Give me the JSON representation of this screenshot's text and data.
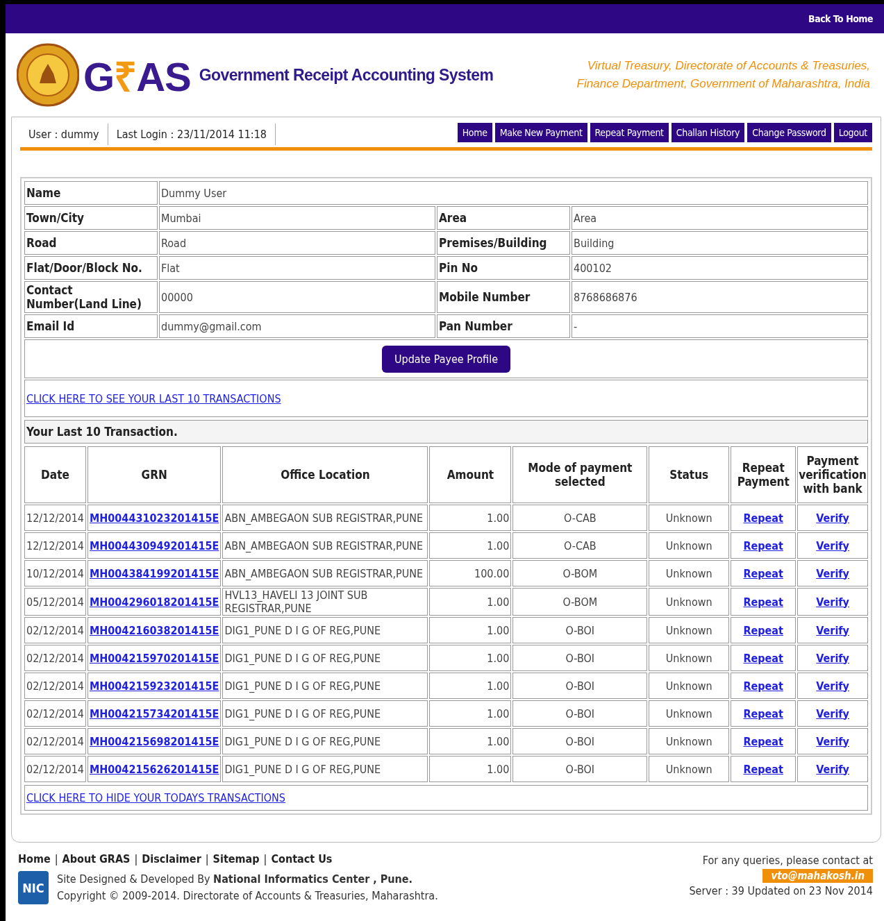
{
  "top_bar": {
    "link": "Back To Home"
  },
  "header": {
    "logo_text_left": "G",
    "logo_text_rupee": "₹",
    "logo_text_right": "AS",
    "system_name": "Government Receipt Accounting System",
    "org_lines": [
      "Virtual Treasury, Directorate of Accounts & Treasuries,",
      "Finance Department, Government of Maharashtra, India"
    ]
  },
  "user_bar": {
    "user": "User : dummy",
    "last_login": "Last Login : 23/11/2014 11:18"
  },
  "nav": [
    {
      "label": "Home"
    },
    {
      "label": "Make New Payment"
    },
    {
      "label": "Repeat Payment"
    },
    {
      "label": "Challan History"
    },
    {
      "label": "Change Password"
    },
    {
      "label": "Logout"
    }
  ],
  "profile": [
    {
      "cells": [
        {
          "label": "Name",
          "value": "Dummy User"
        }
      ]
    },
    {
      "cells": [
        {
          "label": "Town/City",
          "value": "Mumbai"
        },
        {
          "label": "Area",
          "value": "Area"
        }
      ]
    },
    {
      "cells": [
        {
          "label": "Road",
          "value": "Road"
        },
        {
          "label": "Premises/Building",
          "value": "Building"
        }
      ]
    },
    {
      "cells": [
        {
          "label": "Flat/Door/Block No.",
          "value": "Flat"
        },
        {
          "label": "Pin No",
          "value": "400102"
        }
      ]
    },
    {
      "cells": [
        {
          "label": "Contact Number(Land Line)",
          "value": "00000"
        },
        {
          "label": "Mobile Number",
          "value": "8768686876"
        }
      ]
    },
    {
      "cells": [
        {
          "label": "Email Id",
          "value": "dummy@gmail.com"
        },
        {
          "label": "Pan Number",
          "value": "-"
        }
      ]
    }
  ],
  "update_button": "Update Payee Profile",
  "show_link": "CLICK HERE TO SEE YOUR LAST 10 TRANSACTIONS",
  "transactions": {
    "title": "Your Last 10 Transaction.",
    "columns": [
      "Date",
      "GRN",
      "Office Location",
      "Amount",
      "Mode of payment selected",
      "Status",
      "Repeat Payment",
      "Payment verification with bank"
    ],
    "rows": [
      [
        "12/12/2014",
        "MH004431023201415E",
        "ABN_AMBEGAON SUB REGISTRAR,PUNE",
        "1.00",
        "O-CAB",
        "Unknown",
        "Repeat",
        "Verify"
      ],
      [
        "12/12/2014",
        "MH004430949201415E",
        "ABN_AMBEGAON SUB REGISTRAR,PUNE",
        "1.00",
        "O-CAB",
        "Unknown",
        "Repeat",
        "Verify"
      ],
      [
        "10/12/2014",
        "MH004384199201415E",
        "ABN_AMBEGAON SUB REGISTRAR,PUNE",
        "100.00",
        "O-BOM",
        "Unknown",
        "Repeat",
        "Verify"
      ],
      [
        "05/12/2014",
        "MH004296018201415E",
        "HVL13_HAVELI 13 JOINT SUB REGISTRAR,PUNE",
        "1.00",
        "O-BOM",
        "Unknown",
        "Repeat",
        "Verify"
      ],
      [
        "02/12/2014",
        "MH004216038201415E",
        "DIG1_PUNE D I G OF REG,PUNE",
        "1.00",
        "O-BOI",
        "Unknown",
        "Repeat",
        "Verify"
      ],
      [
        "02/12/2014",
        "MH004215970201415E",
        "DIG1_PUNE D I G OF REG,PUNE",
        "1.00",
        "O-BOI",
        "Unknown",
        "Repeat",
        "Verify"
      ],
      [
        "02/12/2014",
        "MH004215923201415E",
        "DIG1_PUNE D I G OF REG,PUNE",
        "1.00",
        "O-BOI",
        "Unknown",
        "Repeat",
        "Verify"
      ],
      [
        "02/12/2014",
        "MH004215734201415E",
        "DIG1_PUNE D I G OF REG,PUNE",
        "1.00",
        "O-BOI",
        "Unknown",
        "Repeat",
        "Verify"
      ],
      [
        "02/12/2014",
        "MH004215698201415E",
        "DIG1_PUNE D I G OF REG,PUNE",
        "1.00",
        "O-BOI",
        "Unknown",
        "Repeat",
        "Verify"
      ],
      [
        "02/12/2014",
        "MH004215626201415E",
        "DIG1_PUNE D I G OF REG,PUNE",
        "1.00",
        "O-BOI",
        "Unknown",
        "Repeat",
        "Verify"
      ]
    ],
    "hide_link": "CLICK HERE TO HIDE YOUR TODAYS TRANSACTIONS"
  },
  "footer": {
    "links": [
      "Home",
      "About GRAS",
      "Disclaimer",
      "Sitemap",
      "Contact Us"
    ],
    "separator": "|",
    "nic_logo": "NIC",
    "credit": "Site Designed & Developed By **National Informatics Center , Pune.**",
    "copyright": "Copyright © 2009-2014. Directorate of Accounts & Treasuries, Maharashtra.",
    "query": "For any queries, please contact at",
    "email": "vto@mahakosh.in",
    "server": "Server : 39 Updated on 23 Nov 2014"
  }
}
